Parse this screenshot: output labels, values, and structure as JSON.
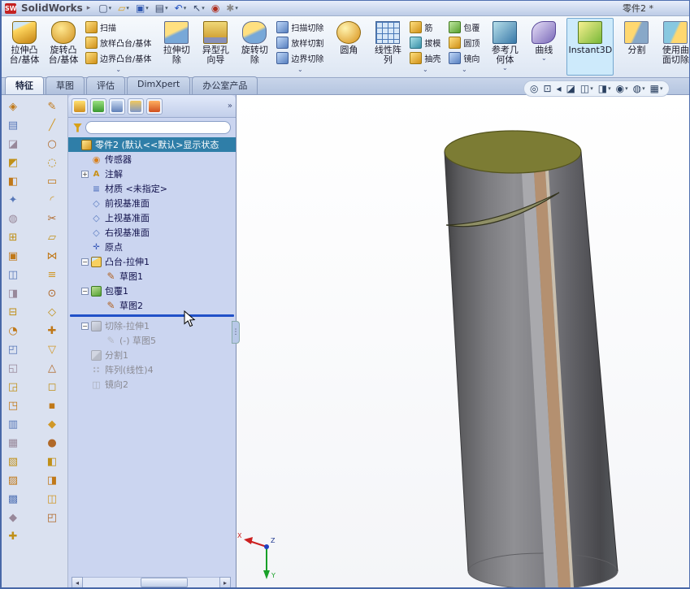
{
  "window": {
    "app_name": "SolidWorks",
    "logo_abbr": "SW",
    "doc_title": "零件2 *",
    "menu_arrow": "▸"
  },
  "titlebar": {
    "icons": [
      {
        "name": "new-document-button",
        "glyph": "▢",
        "arrow": true
      },
      {
        "name": "open-button",
        "glyph": "▱",
        "arrow": true
      },
      {
        "name": "save-button",
        "glyph": "▣",
        "arrow": true
      },
      {
        "name": "print-button",
        "glyph": "▤",
        "arrow": true
      },
      {
        "name": "undo-button",
        "glyph": "↶",
        "arrow": true
      },
      {
        "name": "select-button",
        "glyph": "↖",
        "arrow": true
      },
      {
        "name": "rebuild-button",
        "glyph": "◉",
        "arrow": false
      },
      {
        "name": "options-button",
        "glyph": "✱",
        "arrow": true
      }
    ]
  },
  "ribbon": {
    "buttons": {
      "extrude_boss": {
        "l1": "拉伸凸",
        "l2": "台/基体"
      },
      "revolve_boss": {
        "l1": "旋转凸",
        "l2": "台/基体"
      },
      "sweep": {
        "label": "扫描"
      },
      "loft_boss": {
        "label": "放样凸台/基体"
      },
      "boundary_boss": {
        "label": "边界凸台/基体"
      },
      "extrude_cut": {
        "l1": "拉伸切",
        "l2": "除"
      },
      "hole_wizard": {
        "l1": "异型孔",
        "l2": "向导"
      },
      "revolve_cut": {
        "l1": "旋转切",
        "l2": "除"
      },
      "sweep_cut": {
        "label": "扫描切除"
      },
      "loft_cut": {
        "label": "放样切割"
      },
      "boundary_cut": {
        "label": "边界切除"
      },
      "fillet": {
        "label": "圆角"
      },
      "linear_pattern": {
        "l1": "线性阵",
        "l2": "列"
      },
      "rib": {
        "label": "筋"
      },
      "draft": {
        "label": "拔模"
      },
      "shell": {
        "label": "抽壳"
      },
      "wrap": {
        "label": "包覆"
      },
      "dome": {
        "label": "圆顶"
      },
      "mirror": {
        "label": "镜向"
      },
      "ref_geometry": {
        "l1": "参考几",
        "l2": "何体"
      },
      "curves": {
        "label": "曲线"
      },
      "instant3d": {
        "label": "Instant3D"
      },
      "split": {
        "label": "分割"
      },
      "surface_cut": {
        "l1": "使用曲",
        "l2": "面切除"
      }
    }
  },
  "tabs": {
    "items": [
      "特征",
      "草图",
      "评估",
      "DimXpert",
      "办公室产品"
    ],
    "active": "特征"
  },
  "headsup": {
    "icons": [
      {
        "name": "zoom-to-fit-icon",
        "glyph": "◎"
      },
      {
        "name": "zoom-to-area-icon",
        "glyph": "⊡"
      },
      {
        "name": "previous-view-icon",
        "glyph": "◂"
      },
      {
        "name": "section-view-icon",
        "glyph": "◪"
      },
      {
        "name": "view-orientation-icon",
        "glyph": "◫",
        "arrow": true
      },
      {
        "name": "display-style-icon",
        "glyph": "◨",
        "arrow": true
      },
      {
        "name": "hide-show-items-icon",
        "glyph": "◉",
        "arrow": true
      },
      {
        "name": "edit-appearance-icon",
        "glyph": "◍",
        "arrow": true
      },
      {
        "name": "apply-scene-icon",
        "glyph": "▦",
        "arrow": true
      }
    ]
  },
  "left_toolbar": {
    "col1": [
      "◈",
      "▤",
      "◪",
      "◩",
      "◧",
      "✦",
      "◍",
      "⊞",
      "▣",
      "◫",
      "◨",
      "⊟",
      "◔",
      "◰",
      "◱",
      "◲",
      "◳",
      "▥",
      "▦",
      "▧",
      "▨",
      "▩",
      "◆",
      "✚"
    ],
    "col2": [
      "✎",
      "╱",
      "○",
      "◌",
      "▭",
      "◜",
      "✂",
      "▱",
      "⋈",
      "≡",
      "⊙",
      "◇",
      "✚",
      "▽",
      "△",
      "◻",
      "▪",
      "◆",
      "●",
      "◧",
      "◨",
      "◫",
      "◰"
    ]
  },
  "tree": {
    "manager_tabs": [
      {
        "name": "featuremanager-tab"
      },
      {
        "name": "propertymanager-tab"
      },
      {
        "name": "configurationmanager-tab"
      },
      {
        "name": "dimxpertmanager-tab"
      },
      {
        "name": "displaymanager-tab"
      }
    ],
    "overflow": "»",
    "filter_value": "",
    "root": {
      "label": "零件2 (默认<<默认>显示状态",
      "icon": "part",
      "state": "selected"
    },
    "items": [
      {
        "label": "传感器",
        "level": 1,
        "icon": "sensors"
      },
      {
        "label": "注解",
        "level": 1,
        "icon": "annotations",
        "expander": "plus"
      },
      {
        "label": "材质 <未指定>",
        "level": 1,
        "icon": "material"
      },
      {
        "label": "前视基准面",
        "level": 1,
        "icon": "plane"
      },
      {
        "label": "上视基准面",
        "level": 1,
        "icon": "plane"
      },
      {
        "label": "右视基准面",
        "level": 1,
        "icon": "plane"
      },
      {
        "label": "原点",
        "level": 1,
        "icon": "origin"
      },
      {
        "label": "凸台-拉伸1",
        "level": 1,
        "icon": "boss-extrude",
        "expander": "minus"
      },
      {
        "label": "草图1",
        "level": 2,
        "icon": "sketch"
      },
      {
        "label": "包覆1",
        "level": 1,
        "icon": "wrap",
        "expander": "minus"
      },
      {
        "label": "草图2",
        "level": 2,
        "icon": "sketch"
      },
      {
        "type": "rollback"
      },
      {
        "label": "切除-拉伸1",
        "level": 1,
        "icon": "cut-extrude",
        "expander": "minus",
        "state": "suppressed"
      },
      {
        "label": "(-) 草图5",
        "level": 2,
        "icon": "sketch-gray",
        "state": "suppressed"
      },
      {
        "label": "分割1",
        "level": 1,
        "icon": "split",
        "state": "suppressed"
      },
      {
        "label": "阵列(线性)4",
        "level": 1,
        "icon": "pattern",
        "state": "suppressed"
      },
      {
        "label": "镜向2",
        "level": 1,
        "icon": "mirror",
        "state": "suppressed"
      }
    ]
  },
  "viewport": {
    "triad": {
      "x": "X",
      "y": "Y",
      "z": "Z"
    }
  },
  "colors": {
    "selection": "#2f7ea8",
    "rollback_bar": "#2050c8",
    "cylinder_top_face": "#7c7c34",
    "cylinder_stripe": "#b49070",
    "instant3d_highlight": "#cdeafb"
  }
}
